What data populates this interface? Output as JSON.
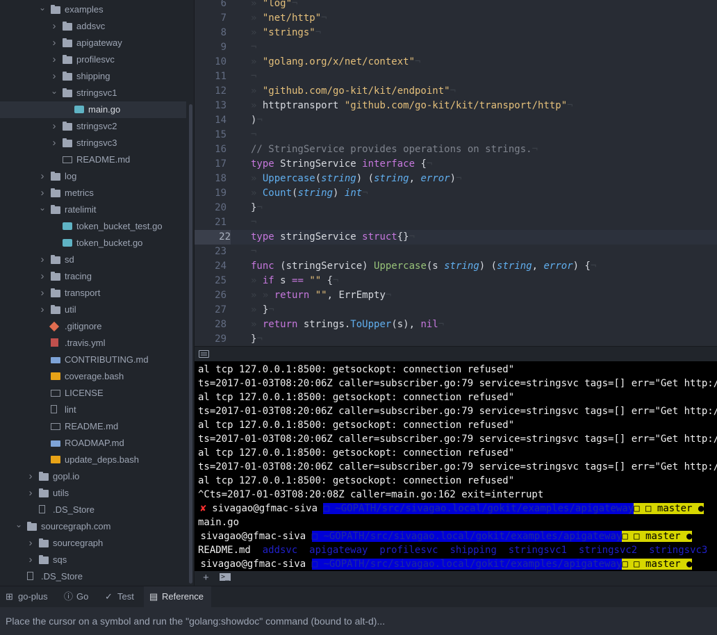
{
  "sidebar": {
    "items": [
      {
        "label": "examples",
        "type": "folder",
        "expanded": true,
        "depth": 1
      },
      {
        "label": "addsvc",
        "type": "folder",
        "expanded": false,
        "depth": 2
      },
      {
        "label": "apigateway",
        "type": "folder",
        "expanded": false,
        "depth": 2
      },
      {
        "label": "profilesvc",
        "type": "folder",
        "expanded": false,
        "depth": 2
      },
      {
        "label": "shipping",
        "type": "folder",
        "expanded": false,
        "depth": 2
      },
      {
        "label": "stringsvc1",
        "type": "folder",
        "expanded": true,
        "depth": 2
      },
      {
        "label": "main.go",
        "type": "go",
        "depth": 3,
        "selected": true
      },
      {
        "label": "stringsvc2",
        "type": "folder",
        "expanded": false,
        "depth": 2
      },
      {
        "label": "stringsvc3",
        "type": "folder",
        "expanded": false,
        "depth": 2
      },
      {
        "label": "README.md",
        "type": "readme",
        "depth": 2
      },
      {
        "label": "log",
        "type": "folder",
        "expanded": false,
        "depth": 1
      },
      {
        "label": "metrics",
        "type": "folder",
        "expanded": false,
        "depth": 1
      },
      {
        "label": "ratelimit",
        "type": "folder",
        "expanded": true,
        "depth": 1
      },
      {
        "label": "token_bucket_test.go",
        "type": "go",
        "depth": 2
      },
      {
        "label": "token_bucket.go",
        "type": "go",
        "depth": 2
      },
      {
        "label": "sd",
        "type": "folder",
        "expanded": false,
        "depth": 1
      },
      {
        "label": "tracing",
        "type": "folder",
        "expanded": false,
        "depth": 1
      },
      {
        "label": "transport",
        "type": "folder",
        "expanded": false,
        "depth": 1
      },
      {
        "label": "util",
        "type": "folder",
        "expanded": false,
        "depth": 1
      },
      {
        "label": ".gitignore",
        "type": "git",
        "depth": 1
      },
      {
        "label": ".travis.yml",
        "type": "travis",
        "depth": 1
      },
      {
        "label": "CONTRIBUTING.md",
        "type": "md",
        "depth": 1
      },
      {
        "label": "coverage.bash",
        "type": "bash",
        "depth": 1
      },
      {
        "label": "LICENSE",
        "type": "readme",
        "depth": 1
      },
      {
        "label": "lint",
        "type": "file",
        "depth": 1
      },
      {
        "label": "README.md",
        "type": "readme",
        "depth": 1
      },
      {
        "label": "ROADMAP.md",
        "type": "md",
        "depth": 1
      },
      {
        "label": "update_deps.bash",
        "type": "bash",
        "depth": 1
      },
      {
        "label": "gopl.io",
        "type": "folder",
        "expanded": false,
        "depth": 0
      },
      {
        "label": "utils",
        "type": "folder",
        "expanded": false,
        "depth": 0
      },
      {
        "label": ".DS_Store",
        "type": "file",
        "depth": 0
      },
      {
        "label": "sourcegraph.com",
        "type": "folder",
        "expanded": true,
        "depth": -1
      },
      {
        "label": "sourcegraph",
        "type": "folder",
        "expanded": false,
        "depth": 0
      },
      {
        "label": "sqs",
        "type": "folder",
        "expanded": false,
        "depth": 0
      },
      {
        "label": ".DS_Store",
        "type": "file",
        "depth": -1
      }
    ]
  },
  "editor": {
    "active_line": 22,
    "lines": [
      {
        "n": "6",
        "tokens": [
          {
            "t": "ws",
            "v": "» "
          },
          {
            "t": "str",
            "v": "\"log\""
          },
          {
            "t": "ws",
            "v": "¬"
          }
        ]
      },
      {
        "n": "7",
        "tokens": [
          {
            "t": "ws",
            "v": "» "
          },
          {
            "t": "str",
            "v": "\"net/http\""
          },
          {
            "t": "ws",
            "v": "¬"
          }
        ]
      },
      {
        "n": "8",
        "tokens": [
          {
            "t": "ws",
            "v": "» "
          },
          {
            "t": "str",
            "v": "\"strings\""
          },
          {
            "t": "ws",
            "v": "¬"
          }
        ]
      },
      {
        "n": "9",
        "tokens": [
          {
            "t": "ws",
            "v": "¬"
          }
        ]
      },
      {
        "n": "10",
        "tokens": [
          {
            "t": "ws",
            "v": "» "
          },
          {
            "t": "str",
            "v": "\"golang.org/x/net/context\""
          },
          {
            "t": "ws",
            "v": "¬"
          }
        ]
      },
      {
        "n": "11",
        "tokens": [
          {
            "t": "ws",
            "v": "¬"
          }
        ]
      },
      {
        "n": "12",
        "tokens": [
          {
            "t": "ws",
            "v": "» "
          },
          {
            "t": "str",
            "v": "\"github.com/go-kit/kit/endpoint\""
          },
          {
            "t": "ws",
            "v": "¬"
          }
        ]
      },
      {
        "n": "13",
        "tokens": [
          {
            "t": "ws",
            "v": "» "
          },
          {
            "t": "pl",
            "v": "httptransport "
          },
          {
            "t": "str",
            "v": "\"github.com/go-kit/kit/transport/http\""
          },
          {
            "t": "ws",
            "v": "¬"
          }
        ]
      },
      {
        "n": "14",
        "tokens": [
          {
            "t": "pl",
            "v": ")"
          },
          {
            "t": "ws",
            "v": "¬"
          }
        ]
      },
      {
        "n": "15",
        "tokens": [
          {
            "t": "ws",
            "v": "¬"
          }
        ]
      },
      {
        "n": "16",
        "tokens": [
          {
            "t": "cm",
            "v": "// StringService provides operations on strings."
          },
          {
            "t": "ws",
            "v": "¬"
          }
        ]
      },
      {
        "n": "17",
        "tokens": [
          {
            "t": "kw",
            "v": "type"
          },
          {
            "t": "pl",
            "v": " StringService "
          },
          {
            "t": "kw",
            "v": "interface"
          },
          {
            "t": "pl",
            "v": " {"
          },
          {
            "t": "ws",
            "v": "¬"
          }
        ]
      },
      {
        "n": "18",
        "tokens": [
          {
            "t": "ws",
            "v": "» "
          },
          {
            "t": "fn",
            "v": "Uppercase"
          },
          {
            "t": "pl",
            "v": "("
          },
          {
            "t": "ty",
            "v": "string"
          },
          {
            "t": "pl",
            "v": ") ("
          },
          {
            "t": "ty",
            "v": "string"
          },
          {
            "t": "pl",
            "v": ", "
          },
          {
            "t": "ty",
            "v": "error"
          },
          {
            "t": "pl",
            "v": ")"
          },
          {
            "t": "ws",
            "v": "¬"
          }
        ]
      },
      {
        "n": "19",
        "tokens": [
          {
            "t": "ws",
            "v": "» "
          },
          {
            "t": "fn",
            "v": "Count"
          },
          {
            "t": "pl",
            "v": "("
          },
          {
            "t": "ty",
            "v": "string"
          },
          {
            "t": "pl",
            "v": ") "
          },
          {
            "t": "ty",
            "v": "int"
          },
          {
            "t": "ws",
            "v": "¬"
          }
        ]
      },
      {
        "n": "20",
        "tokens": [
          {
            "t": "pl",
            "v": "}"
          },
          {
            "t": "ws",
            "v": "¬"
          }
        ]
      },
      {
        "n": "21",
        "tokens": [
          {
            "t": "ws",
            "v": "¬"
          }
        ]
      },
      {
        "n": "22",
        "tokens": [
          {
            "t": "kw",
            "v": "type"
          },
          {
            "t": "pl",
            "v": " stringService "
          },
          {
            "t": "kw",
            "v": "struct"
          },
          {
            "t": "pl",
            "v": "{}"
          },
          {
            "t": "ws",
            "v": "¬"
          }
        ]
      },
      {
        "n": "23",
        "tokens": [
          {
            "t": "ws",
            "v": "¬"
          }
        ]
      },
      {
        "n": "24",
        "tokens": [
          {
            "t": "kw",
            "v": "func"
          },
          {
            "t": "pl",
            "v": " (stringService) "
          },
          {
            "t": "fn2",
            "v": "Uppercase"
          },
          {
            "t": "pl",
            "v": "(s "
          },
          {
            "t": "ty",
            "v": "string"
          },
          {
            "t": "pl",
            "v": ") ("
          },
          {
            "t": "ty",
            "v": "string"
          },
          {
            "t": "pl",
            "v": ", "
          },
          {
            "t": "ty",
            "v": "error"
          },
          {
            "t": "pl",
            "v": ") {"
          },
          {
            "t": "ws",
            "v": "¬"
          }
        ]
      },
      {
        "n": "25",
        "tokens": [
          {
            "t": "ws",
            "v": "» "
          },
          {
            "t": "kw",
            "v": "if"
          },
          {
            "t": "pl",
            "v": " s "
          },
          {
            "t": "kw",
            "v": "=="
          },
          {
            "t": "pl",
            "v": " "
          },
          {
            "t": "str",
            "v": "\"\""
          },
          {
            "t": "pl",
            "v": " {"
          },
          {
            "t": "ws",
            "v": "¬"
          }
        ]
      },
      {
        "n": "26",
        "tokens": [
          {
            "t": "ws",
            "v": "» » "
          },
          {
            "t": "kw",
            "v": "return"
          },
          {
            "t": "pl",
            "v": " "
          },
          {
            "t": "str",
            "v": "\"\""
          },
          {
            "t": "pl",
            "v": ", ErrEmpty"
          },
          {
            "t": "ws",
            "v": "¬"
          }
        ]
      },
      {
        "n": "27",
        "tokens": [
          {
            "t": "ws",
            "v": "» "
          },
          {
            "t": "pl",
            "v": "}"
          },
          {
            "t": "ws",
            "v": "¬"
          }
        ]
      },
      {
        "n": "28",
        "tokens": [
          {
            "t": "ws",
            "v": "» "
          },
          {
            "t": "kw",
            "v": "return"
          },
          {
            "t": "pl",
            "v": " strings."
          },
          {
            "t": "fn",
            "v": "ToUpper"
          },
          {
            "t": "pl",
            "v": "(s), "
          },
          {
            "t": "nil",
            "v": "nil"
          },
          {
            "t": "ws",
            "v": "¬"
          }
        ]
      },
      {
        "n": "29",
        "tokens": [
          {
            "t": "pl",
            "v": "}"
          },
          {
            "t": "ws",
            "v": "¬"
          }
        ]
      }
    ]
  },
  "terminal": {
    "lines": [
      "al tcp 127.0.0.1:8500: getsockopt: connection refused\"",
      "ts=2017-01-03T08:20:06Z caller=subscriber.go:79 service=stringsvc tags=[] err=\"Get http:/",
      "al tcp 127.0.0.1:8500: getsockopt: connection refused\"",
      "ts=2017-01-03T08:20:06Z caller=subscriber.go:79 service=stringsvc tags=[] err=\"Get http:/",
      "al tcp 127.0.0.1:8500: getsockopt: connection refused\"",
      "ts=2017-01-03T08:20:06Z caller=subscriber.go:79 service=stringsvc tags=[] err=\"Get http:/",
      "al tcp 127.0.0.1:8500: getsockopt: connection refused\"",
      "ts=2017-01-03T08:20:06Z caller=subscriber.go:79 service=stringsvc tags=[] err=\"Get http:/",
      "al tcp 127.0.0.1:8500: getsockopt: connection refused\"",
      "^Cts=2017-01-03T08:20:08Z caller=main.go:162 exit=interrupt"
    ],
    "prompt1": {
      "mark": "✘",
      "user": "sivagao@gfmac-siva",
      "path": "~GOPATH/src/sivagao.local/gokit/examples/apigateway",
      "branch": "master ●"
    },
    "out1": "main.go",
    "prompt2": {
      "user": "sivagao@gfmac-siva",
      "path": "~GOPATH/src/sivagao.local/gokit/examples/apigateway",
      "branch": "master ●"
    },
    "ls_first": "README.md",
    "ls_dirs": [
      "addsvc",
      "apigateway",
      "profilesvc",
      "shipping",
      "stringsvc1",
      "stringsvc2",
      "stringsvc3"
    ],
    "prompt3": {
      "user": "sivagao@gfmac-siva",
      "path": "~GOPATH/src/sivagao.local/gokit/examples/apigateway",
      "branch": "master ●"
    },
    "footer_add": "+",
    "footer_term": ">_"
  },
  "bottom_tabs": [
    {
      "label": "go-plus",
      "icon": "plus-square-icon",
      "active": false
    },
    {
      "label": "Go",
      "icon": "info-icon",
      "active": false
    },
    {
      "label": "Test",
      "icon": "check-icon",
      "active": false
    },
    {
      "label": "Reference",
      "icon": "book-icon",
      "active": true
    }
  ],
  "doc_panel": {
    "text": "Place the cursor on a symbol and run the \"golang:showdoc\" command (bound to alt-d)..."
  },
  "colors": {
    "editor_bg": "#282c34",
    "sidebar_bg": "#21252b",
    "keyword": "#c678dd",
    "string": "#e5c07b",
    "function": "#61afef",
    "prompt_blue": "#0000d7",
    "prompt_yellow": "#d7d700"
  }
}
